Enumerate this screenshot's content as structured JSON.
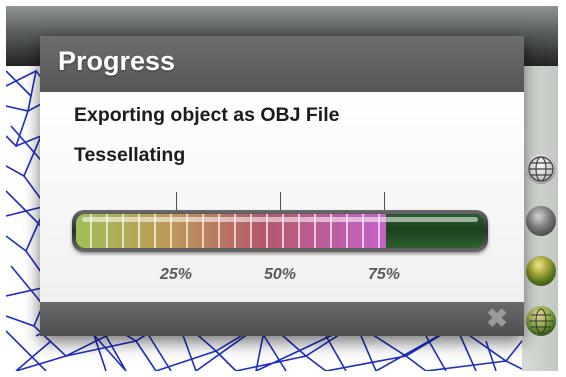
{
  "dialog": {
    "title": "Progress",
    "message": "Exporting object as OBJ File",
    "status": "Tessellating",
    "close_icon": "close-icon"
  },
  "progress": {
    "value_percent": 76,
    "tick_labels": [
      "25%",
      "50%",
      "75%"
    ]
  },
  "sidebar_icons": [
    "wireframe-sphere-icon",
    "gray-sphere-icon",
    "shaded-sphere-icon",
    "textured-sphere-icon"
  ],
  "colors": {
    "header_gray": "#5f5f5f",
    "bar_track_green": "#1b421b",
    "fill_start": "#9fbf58",
    "fill_end": "#c462c9",
    "mesh_blue": "#1d2fc2"
  }
}
